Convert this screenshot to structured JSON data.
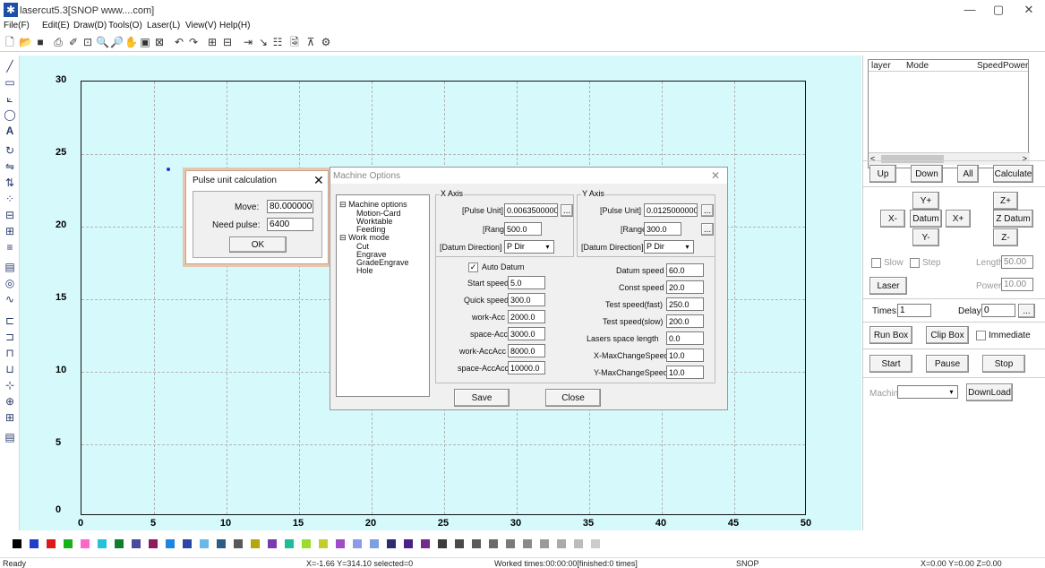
{
  "window": {
    "title": "lasercut5.3[SNOP www....com]",
    "controls": [
      "—",
      "▢",
      "✕"
    ]
  },
  "menu": [
    "File(F)",
    "Edit(E)",
    "Draw(D)",
    "Tools(O)",
    "Laser(L)",
    "View(V)",
    "Help(H)"
  ],
  "canvas": {
    "x_ticks": [
      "0",
      "5",
      "10",
      "15",
      "20",
      "25",
      "30",
      "35",
      "40",
      "45",
      "50"
    ],
    "y_ticks": [
      "30",
      "25",
      "20",
      "15",
      "10",
      "5",
      "0"
    ],
    "background": "#d6f9fc"
  },
  "layer_table": {
    "headers": [
      "layer",
      "Mode",
      "Speed",
      "Power"
    ],
    "scroll_left": "<",
    "scroll_right": ">"
  },
  "right_panel": {
    "up": "Up",
    "down": "Down",
    "all": "All",
    "calculate": "Calculate",
    "y_plus": "Y+",
    "z_plus": "Z+",
    "x_minus": "X-",
    "datum": "Datum",
    "x_plus": "X+",
    "z_datum": "Z Datum",
    "y_minus": "Y-",
    "z_minus": "Z-",
    "slow": "Slow",
    "step": "Step",
    "length_label": "Length:",
    "length_value": "50.00",
    "laser": "Laser",
    "power_label": "Power:",
    "power_value": "10.00",
    "times_label": "Times:",
    "times_value": "1",
    "delay_label": "Delay:",
    "delay_value": "0",
    "ellipsis": "...",
    "run_box": "Run Box",
    "clip_box": "Clip Box",
    "immediate": "Immediate",
    "start": "Start",
    "pause": "Pause",
    "stop": "Stop",
    "machine_label": "Machine:",
    "download": "DownLoad"
  },
  "pulse_dialog": {
    "title": "Pulse unit calculation",
    "move_label": "Move:",
    "move_value": "80.000000",
    "need_pulse_label": "Need pulse:",
    "need_pulse_value": "6400",
    "ok": "OK"
  },
  "machine_options": {
    "title": "Machine Options",
    "tree": [
      {
        "label": "Machine options",
        "level": 0,
        "expander": "⊟"
      },
      {
        "label": "Motion-Card",
        "level": 1
      },
      {
        "label": "Worktable",
        "level": 1
      },
      {
        "label": "Feeding",
        "level": 1
      },
      {
        "label": "Work mode",
        "level": 0,
        "expander": "⊟"
      },
      {
        "label": "Cut",
        "level": 1
      },
      {
        "label": "Engrave",
        "level": 1
      },
      {
        "label": "GradeEngrave",
        "level": 1
      },
      {
        "label": "Hole",
        "level": 1
      }
    ],
    "x_axis": {
      "title": "X Axis",
      "pulse_unit_label": "[Pulse Unit]",
      "pulse_unit_value": "0.0063500000",
      "range_label": "[Range]",
      "range_value": "500.0",
      "datum_dir_label": "[Datum Direction]",
      "datum_dir_value": "P Dir"
    },
    "y_axis": {
      "title": "Y Axis",
      "pulse_unit_label": "[Pulse Unit]",
      "pulse_unit_value": "0.0125000000",
      "range_label": "[Range]",
      "range_value": "300.0",
      "datum_dir_label": "[Datum Direction]",
      "datum_dir_value": "P Dir"
    },
    "auto_datum": "Auto Datum",
    "left_params": [
      {
        "label": "Start speed",
        "value": "5.0"
      },
      {
        "label": "Quick speed",
        "value": "300.0"
      },
      {
        "label": "work-Acc",
        "value": "2000.0"
      },
      {
        "label": "space-Acc",
        "value": "3000.0"
      },
      {
        "label": "work-AccAcc",
        "value": "8000.0"
      },
      {
        "label": "space-AccAcc",
        "value": "10000.0"
      }
    ],
    "right_params": [
      {
        "label": "Datum speed",
        "value": "60.0"
      },
      {
        "label": "Const speed",
        "value": "20.0"
      },
      {
        "label": "Test speed(fast)",
        "value": "250.0"
      },
      {
        "label": "Test speed(slow)",
        "value": "200.0"
      },
      {
        "label": "Lasers space length",
        "value": "0.0"
      },
      {
        "label": "X-MaxChangeSpeed",
        "value": "10.0"
      },
      {
        "label": "Y-MaxChangeSpeed",
        "value": "10.0"
      }
    ],
    "save": "Save",
    "close": "Close"
  },
  "palette": [
    "#000000",
    "#1f3fc8",
    "#e01818",
    "#17b21a",
    "#ff66cc",
    "#22c3d8",
    "#0f7f2d",
    "#4b4b9c",
    "#8e1b5e",
    "#1e86e0",
    "#2c46a8",
    "#6ab8e8",
    "#2b5d8a",
    "#595959",
    "#b0a80c",
    "#7a3bb0",
    "#1dbd9a",
    "#9adc2d",
    "#c4ce2a",
    "#a04cc7",
    "#8d9ae8",
    "#7d9ee0",
    "#2c2c6e",
    "#4d1f8a",
    "#702d8a",
    "#3c3c3c",
    "#4a4a4a",
    "#5a5a5a",
    "#6a6a6a",
    "#7a7a7a",
    "#8a8a8a",
    "#9a9a9a",
    "#aaaaaa",
    "#bcbcbc",
    "#cccccc"
  ],
  "status": {
    "ready": "Ready",
    "coords": "X=-1.66 Y=314.10 selected=0",
    "worked": "Worked times:00:00:00[finished:0 times]",
    "brand": "SNOP",
    "xyz": "X=0.00 Y=0.00 Z=0.00"
  }
}
